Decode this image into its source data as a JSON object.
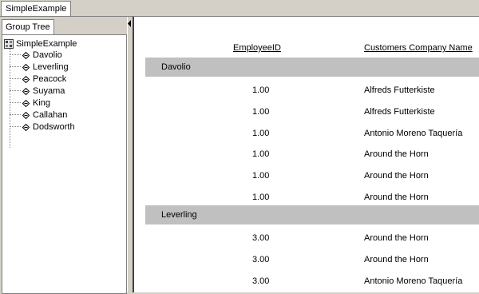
{
  "window": {
    "tab_label": "SimpleExample"
  },
  "group_tree": {
    "tab_label": "Group Tree",
    "root": "SimpleExample",
    "items": [
      "Davolio",
      "Leverling",
      "Peacock",
      "Suyama",
      "King",
      "Callahan",
      "Dodsworth"
    ]
  },
  "report": {
    "columns": {
      "employee_id": "EmployeeID",
      "company_name": "Customers Company Name"
    },
    "groups": [
      {
        "name": "Davolio",
        "rows": [
          {
            "id": "1.00",
            "company": "Alfreds Futterkiste"
          },
          {
            "id": "1.00",
            "company": "Alfreds Futterkiste"
          },
          {
            "id": "1.00",
            "company": "Antonio Moreno Taquería"
          },
          {
            "id": "1.00",
            "company": "Around the Horn"
          },
          {
            "id": "1.00",
            "company": "Around the Horn"
          },
          {
            "id": "1.00",
            "company": "Around the Horn"
          }
        ]
      },
      {
        "name": "Leverling",
        "rows": [
          {
            "id": "3.00",
            "company": "Around the Horn"
          },
          {
            "id": "3.00",
            "company": "Around the Horn"
          },
          {
            "id": "3.00",
            "company": "Antonio Moreno Taquería"
          }
        ]
      }
    ]
  }
}
